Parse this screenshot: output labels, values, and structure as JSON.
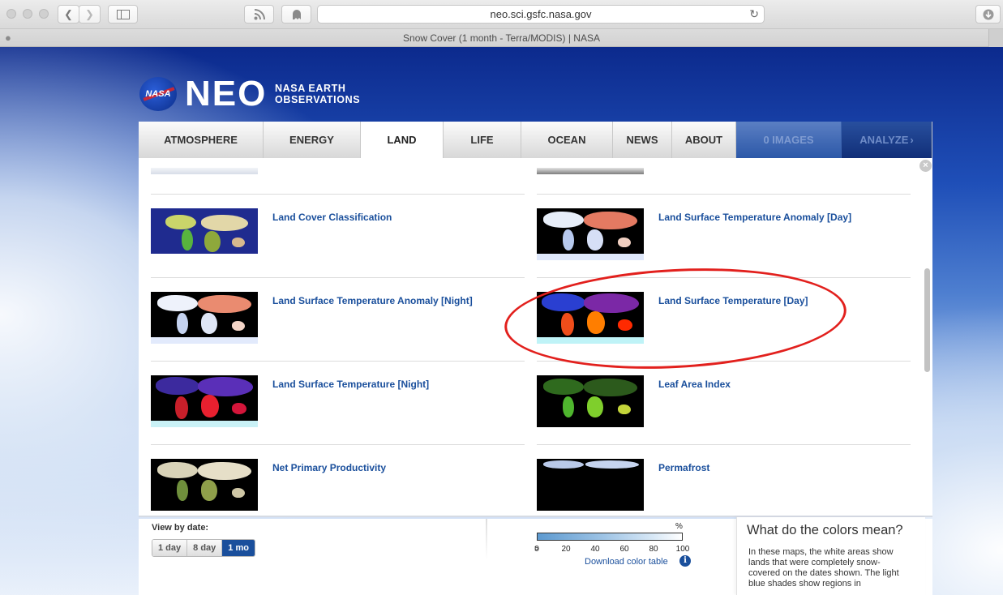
{
  "browser": {
    "url": "neo.sci.gsfc.nasa.gov",
    "tab_title": "Snow Cover (1 month - Terra/MODIS) | NASA"
  },
  "header": {
    "logo_text": "NASA",
    "site_title": "NEO",
    "site_subtitle_line1": "NASA EARTH",
    "site_subtitle_line2": "OBSERVATIONS"
  },
  "nav": {
    "items": [
      {
        "label": "ATMOSPHERE"
      },
      {
        "label": "ENERGY"
      },
      {
        "label": "LAND"
      },
      {
        "label": "LIFE"
      },
      {
        "label": "OCEAN"
      },
      {
        "label": "NEWS"
      },
      {
        "label": "ABOUT"
      },
      {
        "label": "0 IMAGES"
      },
      {
        "label": "ANALYZE"
      }
    ],
    "active": "LAND"
  },
  "datasets": [
    {
      "title": "Land Cover Classification"
    },
    {
      "title": "Land Surface Temperature Anomaly [Day]"
    },
    {
      "title": "Land Surface Temperature Anomaly [Night]"
    },
    {
      "title": "Land Surface Temperature [Day]"
    },
    {
      "title": "Land Surface Temperature [Night]"
    },
    {
      "title": "Leaf Area Index"
    },
    {
      "title": "Net Primary Productivity"
    },
    {
      "title": "Permafrost"
    }
  ],
  "date_view": {
    "label": "View by date:",
    "options": [
      "1 day",
      "8 day",
      "1 mo"
    ],
    "selected": "1 mo"
  },
  "color_table": {
    "unit": "%",
    "ticks": [
      "0",
      "20",
      "40",
      "60",
      "80",
      "100"
    ],
    "prefix": ">",
    "download_label": "Download color table",
    "info_icon": "i"
  },
  "colors_info": {
    "title": "What do the colors mean?",
    "text": "In these maps, the white areas show lands that were completely snow-covered on the dates shown. The light blue shades show regions in"
  },
  "colors": {
    "link": "#1a4f9c",
    "annotation": "#e2201d",
    "active_button": "#1a4f9c"
  }
}
